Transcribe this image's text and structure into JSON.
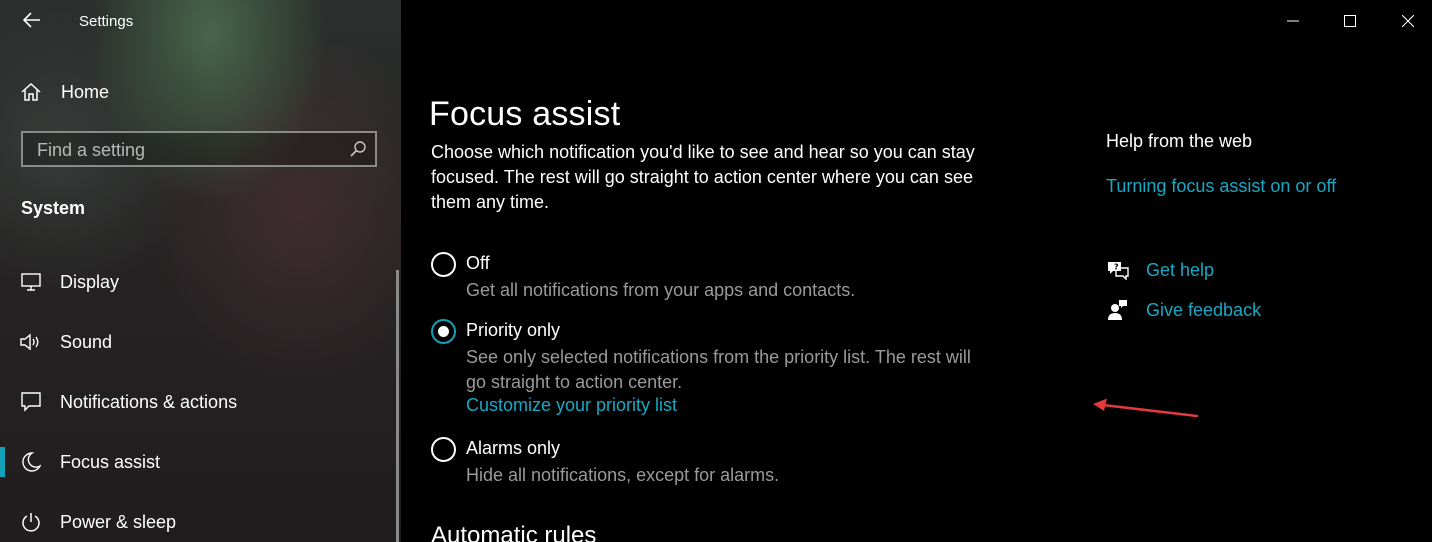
{
  "app": {
    "title": "Settings"
  },
  "sidebar": {
    "home_label": "Home",
    "search": {
      "placeholder": "Find a setting",
      "value": ""
    },
    "section_title": "System",
    "items": [
      {
        "label": "Display",
        "icon": "monitor-icon"
      },
      {
        "label": "Sound",
        "icon": "speaker-icon"
      },
      {
        "label": "Notifications & actions",
        "icon": "message-icon"
      },
      {
        "label": "Focus assist",
        "icon": "moon-icon",
        "active": true
      },
      {
        "label": "Power & sleep",
        "icon": "power-icon"
      }
    ]
  },
  "main": {
    "title": "Focus assist",
    "description": "Choose which notification you'd like to see and hear so you can stay focused. The rest will go straight to action center where you can see them any time.",
    "options": [
      {
        "label": "Off",
        "description": "Get all notifications from your apps and contacts.",
        "checked": false
      },
      {
        "label": "Priority only",
        "description": "See only selected notifications from the priority list. The rest will go straight to action center.",
        "checked": true,
        "link": "Customize your priority list"
      },
      {
        "label": "Alarms only",
        "description": "Hide all notifications, except for alarms.",
        "checked": false
      }
    ],
    "next_section": "Automatic rules"
  },
  "help": {
    "title": "Help from the web",
    "link": "Turning focus assist on or off",
    "get_help": "Get help",
    "give_feedback": "Give feedback"
  },
  "colors": {
    "accent": "#13a0b8",
    "link": "#19a8c4",
    "secondary_text": "#9a9a9a",
    "annotation_arrow": "#e0393e"
  }
}
